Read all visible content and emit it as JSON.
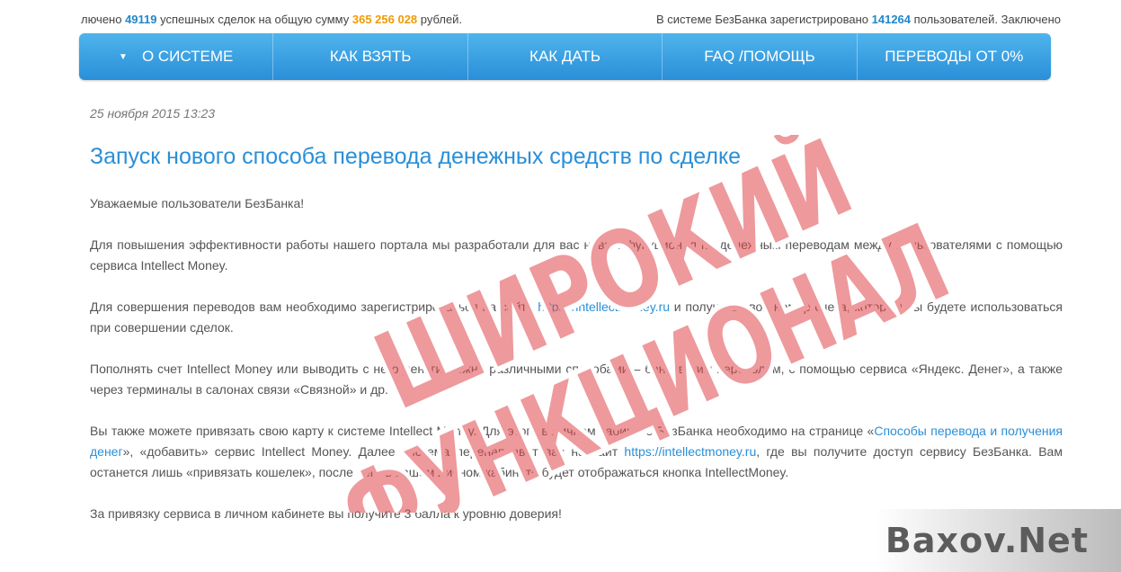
{
  "ticker": {
    "left_a": "лючено ",
    "left_deals": "49119",
    "left_b": " успешных сделок на общую сумму ",
    "left_sum": "365 256 028",
    "left_c": " рублей.",
    "right_a": "В системе БезБанка зарегистрировано ",
    "right_users": "141264",
    "right_b": " пользователей. Заключено"
  },
  "nav": {
    "items": [
      {
        "label": "О СИСТЕМЕ"
      },
      {
        "label": "КАК ВЗЯТЬ"
      },
      {
        "label": "КАК ДАТЬ"
      },
      {
        "label": "FAQ /ПОМОЩЬ"
      },
      {
        "label": "ПЕРЕВОДЫ ОТ 0%"
      }
    ],
    "caret_icon": "caret-down-icon"
  },
  "article": {
    "date": "25 ноября 2015 13:23",
    "title": "Запуск нового способа перевода денежных средств по сделке",
    "greeting": "Уважаемые пользователи БезБанка!",
    "p1": "Для повышения эффективности работы нашего портала мы разработали для вас новый функционал по денежным переводам между пользователями с помощью сервиса Intellect Money.",
    "p2_a": "Для совершения переводов вам необходимо зарегистрироваться на сайте ",
    "p2_link": "https://intellectmoney.ru",
    "p2_b": " и получить свой номер счета, который вы будете использоваться при совершении сделок.",
    "p3": "Пополнять счет Intellect Money или выводить с него деньги можно различными способами – банковским переводом, с помощью сервиса «Яндекс. Денег», а также через терминалы в салонах связи «Связной» и др.",
    "p4_a": "Вы также можете привязать свою карту к системе Intellect Money. Для этого в личном кабинете БезБанка необходимо на странице «",
    "p4_link1": "Способы перевода и получения денег",
    "p4_b": "», «добавить» сервис Intellect Money. Далее система перенаправит вас на сайт ",
    "p4_link2": "https://intellectmoney.ru",
    "p4_c": ", где вы получите доступ сервису БезБанка. Вам останется лишь «привязать кошелек», после чего в вашем личном кабинете будет отображаться кнопка IntellectMoney.",
    "p5": "За привязку сервиса в личном кабинете вы получите 3 балла к уровню доверия!"
  },
  "stamp": {
    "line1": "ШИРОКИЙ",
    "line2": "ФУНКЦИОНАЛ",
    "color": "#e0454a"
  },
  "watermark": {
    "text": "Baxov.Net"
  }
}
